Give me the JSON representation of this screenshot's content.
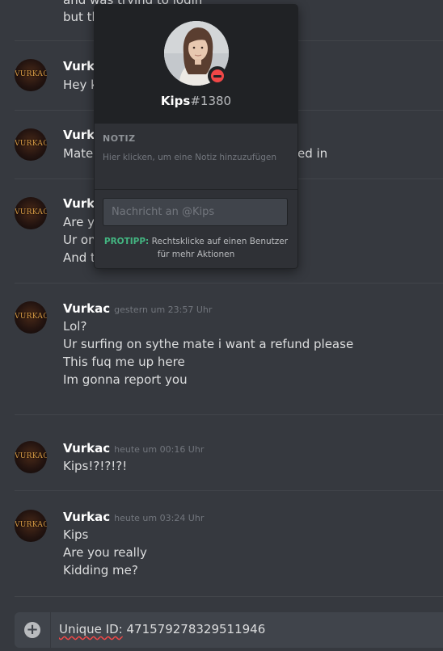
{
  "messages": {
    "top_lines": [
      "and was trying to login",
      "but th"
    ],
    "group2": {
      "author": "Vurkac",
      "lines": [
        "Hey k"
      ]
    },
    "group3": {
      "author": "Vurkac",
      "lines": [
        "Mate",
        "ed in"
      ]
    },
    "group4": {
      "author": "Vurkac",
      "lines": [
        "Are yo",
        "Ur on",
        "And th"
      ]
    },
    "group5": {
      "author": "Vurkac",
      "timestamp": "gestern um 23:57 Uhr",
      "lines": [
        "Lol?",
        "Ur surfing on sythe mate i want a refund please",
        "This fuq me up here",
        "Im gonna report you"
      ]
    },
    "group6": {
      "author": "Vurkac",
      "timestamp": "heute um 00:16 Uhr",
      "lines": [
        "Kips!?!?!?!"
      ]
    },
    "group7": {
      "author": "Vurkac",
      "timestamp": "heute um 03:24 Uhr",
      "lines": [
        "Kips",
        "Are you really",
        "Kidding me?"
      ]
    }
  },
  "avatar_text": "VURKAC",
  "composer": {
    "plus_icon": "plus-circle-icon",
    "text_underlined": "Unique ID:",
    "text_rest": " 471579278329511946"
  },
  "popout": {
    "username": "Kips",
    "discriminator": "#1380",
    "status": "do-not-disturb",
    "status_color": "#f04747",
    "note_label": "NOTIZ",
    "note_placeholder": "Hier klicken, um eine Notiz hinzuzufügen",
    "message_placeholder": "Nachricht an @Kips",
    "protip_label": "PROTIPP:",
    "protip_text": " Rechtsklicke auf einen Benutzer für mehr Aktionen"
  },
  "colors": {
    "background": "#36393f",
    "popout_header": "#202225",
    "protip_green": "#43b581"
  }
}
